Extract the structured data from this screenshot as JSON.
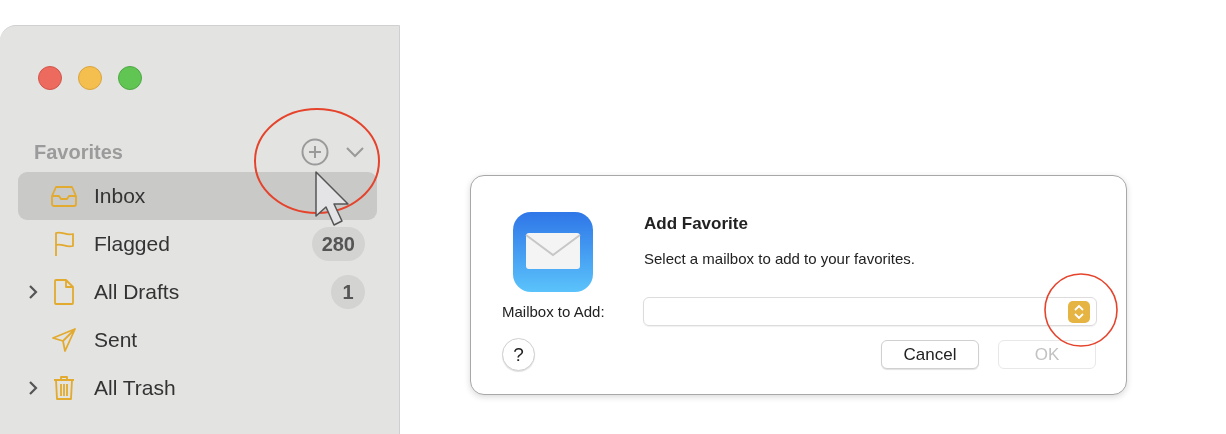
{
  "sidebar": {
    "section": "Favorites",
    "add_circled": true,
    "pointer": true,
    "items": [
      {
        "label": "Inbox",
        "kind": "inbox",
        "expandable": false,
        "selected": true
      },
      {
        "label": "Flagged",
        "kind": "flag",
        "count": "280",
        "expandable": false,
        "selected": false
      },
      {
        "label": "All Drafts",
        "kind": "draft",
        "count": "1",
        "expandable": true,
        "selected": false
      },
      {
        "label": "Sent",
        "kind": "sent",
        "expandable": false,
        "selected": false
      },
      {
        "label": "All Trash",
        "kind": "trash",
        "expandable": true,
        "selected": false
      }
    ]
  },
  "dialog": {
    "title": "Add Favorite",
    "message": "Select a mailbox to add to your favorites.",
    "field_label": "Mailbox to Add:",
    "popup_circled": true,
    "help": "?",
    "buttons": [
      {
        "label": "Cancel",
        "disabled": false
      },
      {
        "label": "OK",
        "disabled": true
      }
    ]
  }
}
